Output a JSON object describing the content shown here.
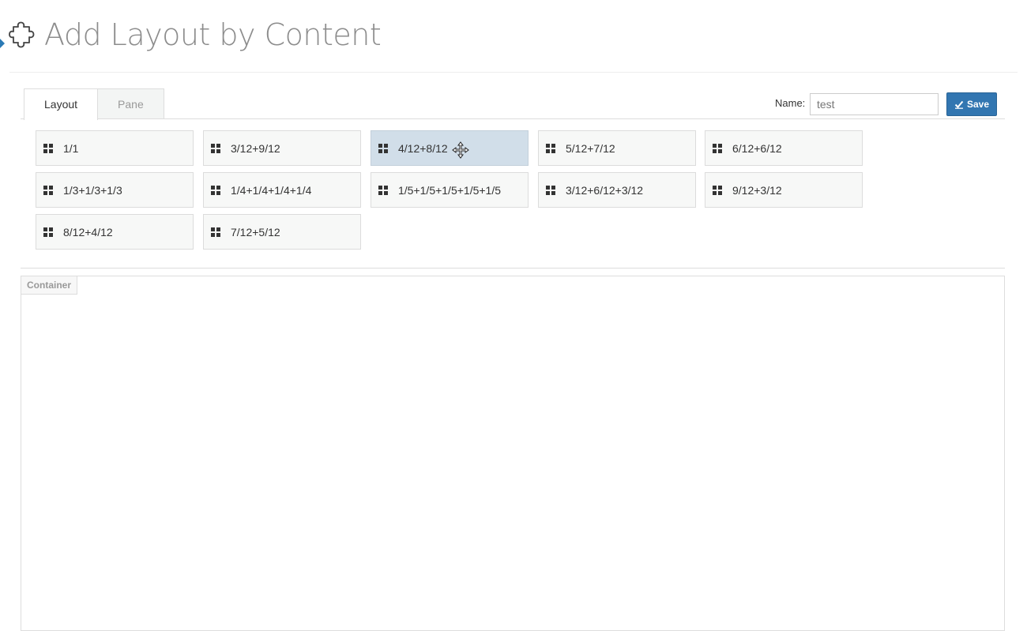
{
  "header": {
    "title": "Add Layout by Content",
    "icon": "puzzle-icon"
  },
  "tabs": [
    {
      "label": "Layout",
      "active": true
    },
    {
      "label": "Pane",
      "active": false
    }
  ],
  "form": {
    "name_label": "Name:",
    "name_value": "test",
    "save_label": "Save"
  },
  "layouts": [
    {
      "label": "1/1"
    },
    {
      "label": "3/12+9/12"
    },
    {
      "label": "4/12+8/12"
    },
    {
      "label": "5/12+7/12"
    },
    {
      "label": "6/12+6/12"
    },
    {
      "label": "1/3+1/3+1/3"
    },
    {
      "label": "1/4+1/4+1/4+1/4"
    },
    {
      "label": "1/5+1/5+1/5+1/5+1/5"
    },
    {
      "label": "3/12+6/12+3/12"
    },
    {
      "label": "9/12+3/12"
    },
    {
      "label": "8/12+4/12"
    },
    {
      "label": "7/12+5/12"
    }
  ],
  "container": {
    "label": "Container"
  },
  "colors": {
    "accent": "#3276b1",
    "hover": "#d1dee9",
    "title": "#8c8c8c"
  }
}
